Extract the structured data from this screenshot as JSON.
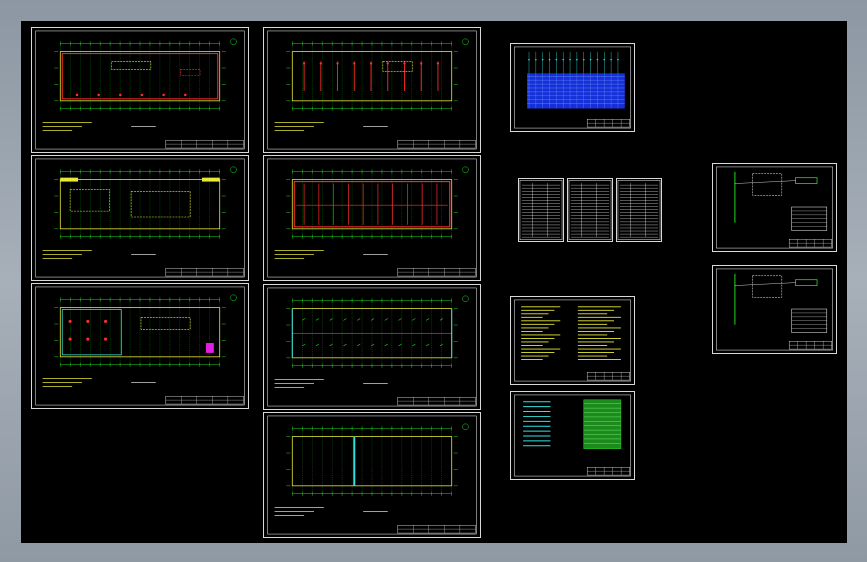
{
  "viewport": {
    "background": "#000000",
    "frame_gradient": "#9aa4ae"
  },
  "colors": {
    "border": "#d8d8d8",
    "grid_green": "#22dd22",
    "wall_yellow": "#e8e83a",
    "red": "#ff2b2b",
    "cyan": "#33e0e0",
    "blue": "#1530d8",
    "magenta": "#e020e0",
    "white": "#ffffff"
  },
  "sheets": [
    {
      "id": "plan-1",
      "kind": "floor-plan",
      "accent": "red"
    },
    {
      "id": "plan-2",
      "kind": "floor-plan",
      "accent": "red-rooms"
    },
    {
      "id": "plan-3",
      "kind": "floor-plan",
      "accent": "yellow"
    },
    {
      "id": "plan-4",
      "kind": "floor-plan",
      "accent": "red-grid"
    },
    {
      "id": "plan-5",
      "kind": "floor-plan",
      "accent": "cyan-rooms"
    },
    {
      "id": "plan-6",
      "kind": "floor-plan",
      "accent": "lighting"
    },
    {
      "id": "plan-7",
      "kind": "floor-plan",
      "accent": "cable"
    },
    {
      "id": "system-diagram",
      "kind": "blue-schedule"
    },
    {
      "id": "table-a",
      "kind": "table"
    },
    {
      "id": "table-b",
      "kind": "table"
    },
    {
      "id": "table-c",
      "kind": "table"
    },
    {
      "id": "notes-yellow",
      "kind": "notes"
    },
    {
      "id": "schedule-green",
      "kind": "schedule"
    },
    {
      "id": "panel-diagram-1",
      "kind": "circuit"
    },
    {
      "id": "panel-diagram-2",
      "kind": "circuit"
    }
  ]
}
